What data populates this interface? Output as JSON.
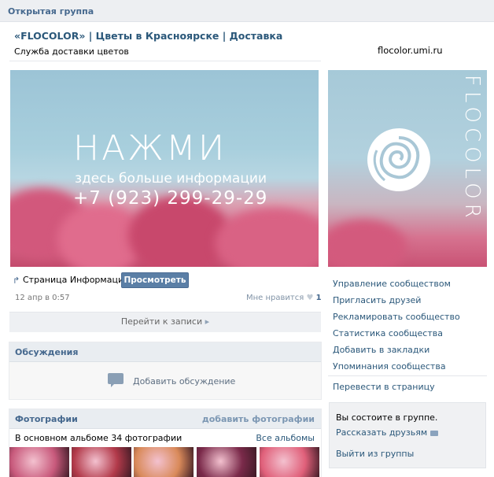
{
  "topbar": {
    "title": "Открытая группа"
  },
  "header": {
    "title": "«FLOCOLOR» | Цветы в Красноярске | Доставка",
    "subtitle": "Служба доставки цветов",
    "website": "flocolor.umi.ru"
  },
  "banner": {
    "headline": "НАЖМИ",
    "tagline": "здесь больше информации",
    "phone": "+7 (923) 299-29-29"
  },
  "side_image": {
    "brand": "FLOCOLOR",
    "logo_icon": "rose-icon"
  },
  "post": {
    "share_icon": "share-arrow-icon",
    "share_text": "Страница Информация",
    "view_button": "Просмотреть",
    "date": "12 апр в 0:57",
    "like_label": "Мне нравится",
    "like_icon": "heart-icon",
    "like_count": "1",
    "goto_label": "Перейти к записи"
  },
  "discussions": {
    "title": "Обсуждения",
    "add_label": "Добавить обсуждение",
    "icon": "speech-bubble-icon"
  },
  "photos": {
    "title": "Фотографии",
    "add_link": "добавить фотографии",
    "meta": "В основном альбоме 34 фотографии",
    "all_link": "Все альбомы",
    "thumb_colors": [
      "#c85a7c",
      "#b23a4a",
      "#d98a5a",
      "#7a2a4a",
      "#e0607a"
    ]
  },
  "menu": {
    "items": [
      "Управление сообществом",
      "Пригласить друзей",
      "Рекламировать сообщество",
      "Статистика сообщества",
      "Добавить в закладки",
      "Упоминания сообщества"
    ],
    "translate": "Перевести в страницу"
  },
  "membership": {
    "status": "Вы состоите в группе.",
    "tell_friends": "Рассказать друзьям",
    "leave": "Выйти из группы"
  },
  "colors": {
    "link": "#2b587a",
    "header": "#45688e",
    "button": "#5b7fa6"
  }
}
